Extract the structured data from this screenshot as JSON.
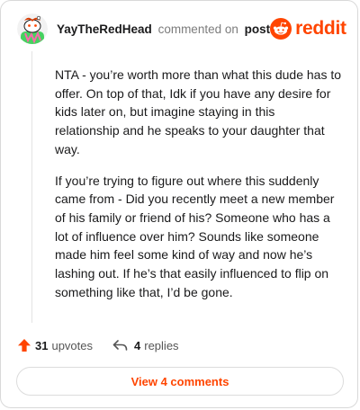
{
  "header": {
    "username": "YayTheRedHead",
    "verb": "commented on",
    "target": "post",
    "brand_word": "reddit"
  },
  "comment": {
    "paragraphs": [
      "NTA - you’re worth more than what this dude has to offer. On top of that, Idk if you have any desire for kids later on, but imagine staying in this relationship and he speaks to your daughter that way.",
      "If you’re trying to figure out where this suddenly came from - Did you recently meet a new member of his family or friend of his? Someone who has a lot of influence over him? Sounds like someone made him feel some kind of way and now he’s lashing out. If he’s that easily influenced to flip on something like that, I’d be gone."
    ]
  },
  "actions": {
    "upvotes_count": "31",
    "upvotes_word": "upvotes",
    "replies_count": "4",
    "replies_word": "replies"
  },
  "view_comments_label": "View 4 comments",
  "colors": {
    "accent": "#ff4500",
    "text": "#1a1a1b",
    "muted": "#7c7c7c"
  },
  "icons": {
    "avatar": "snoo-avatar",
    "brand": "reddit-logo",
    "upvote": "upvote-arrow-icon",
    "reply": "reply-arrow-icon"
  }
}
